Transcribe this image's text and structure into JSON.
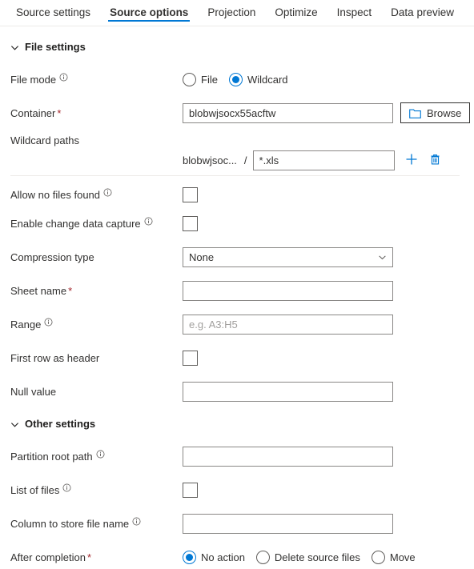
{
  "tabs": [
    {
      "label": "Source settings",
      "active": false
    },
    {
      "label": "Source options",
      "active": true
    },
    {
      "label": "Projection",
      "active": false
    },
    {
      "label": "Optimize",
      "active": false
    },
    {
      "label": "Inspect",
      "active": false
    },
    {
      "label": "Data preview",
      "active": false
    }
  ],
  "accent_color": "#0078d4",
  "required_marker_color": "#a4262c",
  "file_settings": {
    "section_label": "File settings",
    "file_mode": {
      "label": "File mode",
      "info_icon": "info-icon",
      "options": [
        {
          "label": "File",
          "selected": false
        },
        {
          "label": "Wildcard",
          "selected": true
        }
      ]
    },
    "container": {
      "label": "Container",
      "required": "*",
      "value": "blobwjsocx55acftw",
      "browse_label": "Browse",
      "browse_icon": "folder-icon"
    },
    "wildcard_paths": {
      "label": "Wildcard paths",
      "prefix": "blobwjsoc...",
      "separator": "/",
      "value": "*.xls",
      "add_icon": "plus-icon",
      "delete_icon": "trash-icon"
    },
    "allow_no_files_found": {
      "label": "Allow no files found",
      "info_icon": "info-icon",
      "checked": false
    },
    "enable_change_data_capture": {
      "label": "Enable change data capture",
      "info_icon": "info-icon",
      "checked": false
    },
    "compression_type": {
      "label": "Compression type",
      "value": "None",
      "caret_icon": "chevron-down-icon"
    },
    "sheet_name": {
      "label": "Sheet name",
      "required": "*",
      "value": ""
    },
    "range": {
      "label": "Range",
      "info_icon": "info-icon",
      "value": "",
      "placeholder": "e.g. A3:H5"
    },
    "first_row_as_header": {
      "label": "First row as header",
      "checked": false
    },
    "null_value": {
      "label": "Null value",
      "value": ""
    }
  },
  "other_settings": {
    "section_label": "Other settings",
    "partition_root_path": {
      "label": "Partition root path",
      "info_icon": "info-icon",
      "value": ""
    },
    "list_of_files": {
      "label": "List of files",
      "info_icon": "info-icon",
      "checked": false
    },
    "column_to_store_file_name": {
      "label": "Column to store file name",
      "info_icon": "info-icon",
      "value": ""
    },
    "after_completion": {
      "label": "After completion",
      "required": "*",
      "options": [
        {
          "label": "No action",
          "selected": true
        },
        {
          "label": "Delete source files",
          "selected": false
        },
        {
          "label": "Move",
          "selected": false
        }
      ]
    }
  }
}
